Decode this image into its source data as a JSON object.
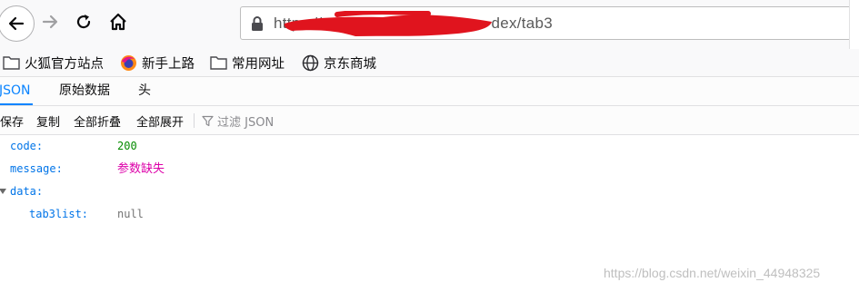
{
  "navigation": {
    "url_visible": "https://…dex/tab3",
    "url_prefix": "https://",
    "url_suffix": "dex/tab3"
  },
  "bookmarks": [
    {
      "label": "火狐官方站点",
      "icon": "folder-icon"
    },
    {
      "label": "新手上路",
      "icon": "firefox-icon"
    },
    {
      "label": "常用网址",
      "icon": "folder-icon"
    },
    {
      "label": "京东商城",
      "icon": "globe-icon"
    }
  ],
  "tabs": [
    {
      "label": "JSON",
      "selected": true
    },
    {
      "label": "原始数据",
      "selected": false
    },
    {
      "label": "头",
      "selected": false
    }
  ],
  "toolbar": {
    "save": "保存",
    "copy": "复制",
    "collapse_all": "全部折叠",
    "expand_all": "全部展开",
    "filter_placeholder": "过滤 JSON"
  },
  "json": {
    "code_key": "code:",
    "code_value": "200",
    "message_key": "message:",
    "message_value": "参数缺失",
    "data_key": "data:",
    "tab3list_key": "tab3list:",
    "tab3list_value": "null"
  },
  "watermark": "https://blog.csdn.net/weixin_44948325",
  "colors": {
    "accent": "#0a84ff",
    "key": "#0074e8",
    "number": "#058b00",
    "string": "#dd00a9",
    "null": "#737373",
    "redaction": "#e0141e"
  }
}
